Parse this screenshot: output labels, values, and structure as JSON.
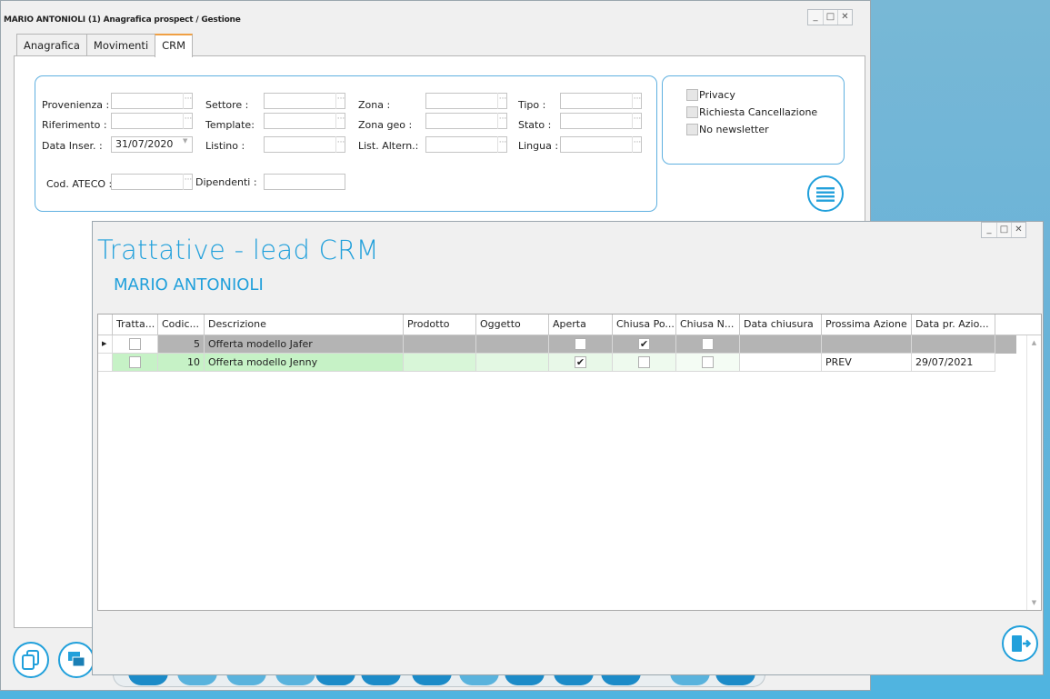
{
  "main_window": {
    "title": "MARIO ANTONIOLI (1) Anagrafica prospect / Gestione",
    "tabs": [
      "Anagrafica",
      "Movimenti",
      "CRM"
    ],
    "active_tab": "CRM",
    "fields": {
      "provenienza": {
        "label": "Provenienza :",
        "value": ""
      },
      "riferimento": {
        "label": "Riferimento :",
        "value": ""
      },
      "data_inser": {
        "label": "Data Inser. :",
        "value": "31/07/2020"
      },
      "settore": {
        "label": "Settore :",
        "value": ""
      },
      "template": {
        "label": "Template:",
        "value": ""
      },
      "listino": {
        "label": "Listino :",
        "value": ""
      },
      "zona": {
        "label": "Zona :",
        "value": ""
      },
      "zona_geo": {
        "label": "Zona geo :",
        "value": ""
      },
      "list_altern": {
        "label": "List. Altern.:",
        "value": ""
      },
      "tipo": {
        "label": "Tipo :",
        "value": ""
      },
      "stato": {
        "label": "Stato :",
        "value": ""
      },
      "lingua": {
        "label": "Lingua :",
        "value": ""
      },
      "cod_ateco": {
        "label": "Cod. ATECO :",
        "value": ""
      },
      "dipendenti": {
        "label": "Dipendenti :",
        "value": ""
      }
    },
    "checkboxes": [
      {
        "label": "Privacy",
        "checked": false
      },
      {
        "label": "Richiesta Cancellazione",
        "checked": false
      },
      {
        "label": "No newsletter",
        "checked": false
      }
    ],
    "menu_icon": "menu-lines-icon",
    "footer_icons": [
      "copy-document-icon",
      "stack-windows-icon"
    ]
  },
  "crm_window": {
    "title": "Trattative - lead CRM",
    "subtitle": "MARIO ANTONIOLI",
    "columns": [
      "Tratta...",
      "Codic...",
      "Descrizione",
      "Prodotto",
      "Oggetto",
      "Aperta",
      "Chiusa Po...",
      "Chiusa N...",
      "Data chiusura",
      "Prossima Azione",
      "Data pr. Azio..."
    ],
    "rows": [
      {
        "trattativa": false,
        "codice": "5",
        "descrizione": "Offerta modello Jafer",
        "prodotto": "",
        "oggetto": "",
        "aperta": false,
        "chiusa_pos": true,
        "chiusa_neg": false,
        "data_chiusura": "",
        "prossima_azione": "",
        "data_pr_azione": "",
        "selected": true
      },
      {
        "trattativa": false,
        "codice": "10",
        "descrizione": "Offerta modello Jenny",
        "prodotto": "",
        "oggetto": "",
        "aperta": true,
        "chiusa_pos": false,
        "chiusa_neg": false,
        "data_chiusura": "",
        "prossima_azione": "PREV",
        "data_pr_azione": "29/07/2021",
        "selected": false
      }
    ],
    "exit_icon": "exit-door-icon"
  },
  "colors": {
    "accent": "#21a0db",
    "selected_row": "#b4b4b4",
    "open_row": "#c6f2c6",
    "tab_highlight": "#f0a044"
  }
}
